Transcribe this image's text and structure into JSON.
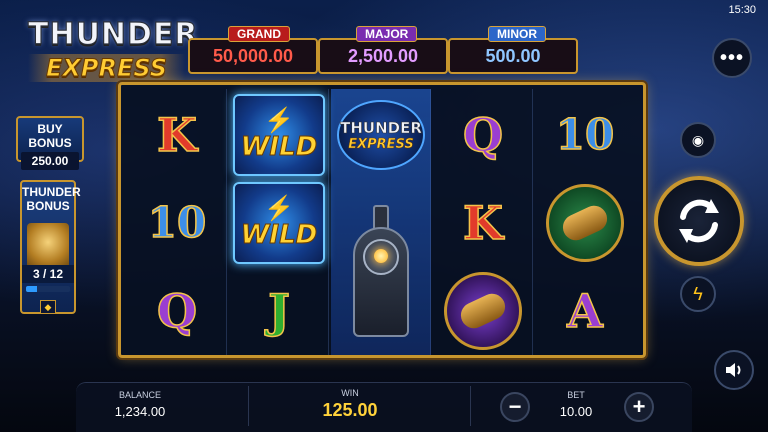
{
  "status": {
    "clock": "15:30"
  },
  "logo": {
    "line1": "THUNDER",
    "line2": "EXPRESS"
  },
  "jackpots": [
    {
      "name": "GRAND",
      "value": "50,000.00",
      "color": "#c0221e"
    },
    {
      "name": "MAJOR",
      "value": "2,500.00",
      "color": "#8a2fc2"
    },
    {
      "name": "MINOR",
      "value": "500.00",
      "color": "#2c6fd4"
    }
  ],
  "buy_bonus": {
    "label": "BUY BONUS",
    "price": "250.00"
  },
  "thunder_bonus": {
    "label_1": "THUNDER",
    "label_2": "BONUS",
    "counter": "3 / 12",
    "progress": 0.25
  },
  "reels": [
    [
      {
        "type": "letter",
        "text": "K"
      },
      {
        "type": "letter",
        "text": "10"
      },
      {
        "type": "letter",
        "text": "Q"
      }
    ],
    [
      {
        "type": "wild",
        "text": "WILD"
      },
      {
        "type": "wild",
        "text": "WILD"
      },
      {
        "type": "letter",
        "text": "J"
      }
    ],
    [
      {
        "type": "logo",
        "text1": "THUNDER",
        "text2": "EXPRESS"
      },
      {
        "type": "train"
      },
      {
        "type": "train"
      }
    ],
    [
      {
        "type": "letter",
        "text": "Q"
      },
      {
        "type": "letter",
        "text": "K"
      },
      {
        "type": "coin-purple"
      }
    ],
    [
      {
        "type": "letter",
        "text": "10"
      },
      {
        "type": "coin-green"
      },
      {
        "type": "letter",
        "text": "A"
      }
    ]
  ],
  "controls": {
    "menu_icon": "more-horizontal-icon",
    "stack_icon": "coin-stack-icon",
    "spin_icon": "refresh-icon",
    "turbo_icon": "lightning-icon",
    "sound_icon": "speaker-icon"
  },
  "bottom_bar": {
    "balance_label": "BALANCE",
    "balance": "1,234.00",
    "win_label": "WIN",
    "win": "125.00",
    "bet_label": "BET",
    "bet": "10.00",
    "minus": "−",
    "plus": "+"
  }
}
